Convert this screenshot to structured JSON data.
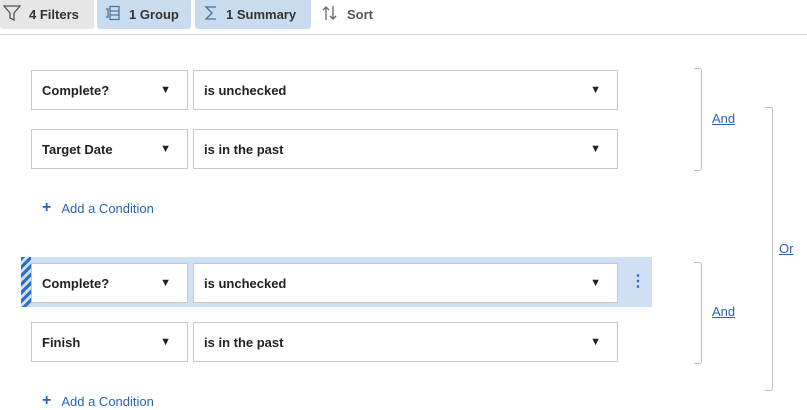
{
  "toolbar": {
    "filters_label": "4 Filters",
    "group_label": "1 Group",
    "summary_label": "1 Summary",
    "sort_label": "Sort"
  },
  "groups": [
    {
      "conditions": [
        {
          "field": "Complete?",
          "operator": "is unchecked"
        },
        {
          "field": "Target Date",
          "operator": "is in the past"
        }
      ],
      "add_label": "Add a Condition",
      "conjunction": "And"
    },
    {
      "conditions": [
        {
          "field": "Complete?",
          "operator": "is unchecked"
        },
        {
          "field": "Finish",
          "operator": "is in the past"
        }
      ],
      "add_label": "Add a Condition",
      "conjunction": "And"
    }
  ],
  "outer_conjunction": "Or",
  "icons": {
    "filter": "funnel-icon",
    "group": "group-icon",
    "summary": "sigma-icon",
    "sort": "sort-arrows-icon",
    "dropdown": "caret-down-icon",
    "add": "plus-icon",
    "more": "kebab-icon",
    "drag": "drag-handle-icon"
  },
  "colors": {
    "accent": "#2a64b0",
    "active_tab": "#c9dcef",
    "highlight_row": "#cfe0f5"
  }
}
